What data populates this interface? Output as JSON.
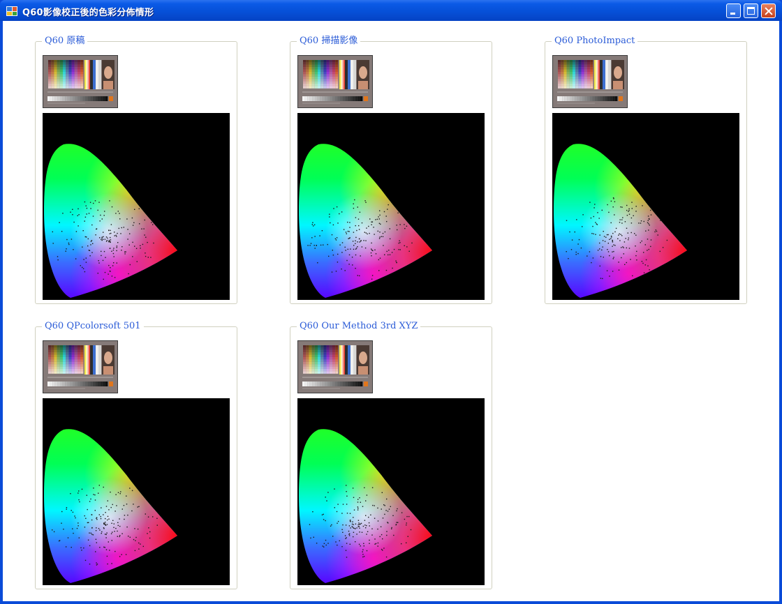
{
  "window": {
    "title": "Q60影像校正後的色彩分佈情形",
    "icon": "app-icon",
    "controls": {
      "minimize": "minimize-icon",
      "maximize": "maximize-icon",
      "close": "close-icon"
    }
  },
  "groups": [
    {
      "title": "Q60 原稿"
    },
    {
      "title": "Q60 掃描影像"
    },
    {
      "title": "Q60 PhotoImpact"
    },
    {
      "title": "Q60 QPcolorsoft 501"
    },
    {
      "title": "Q60 Our Method 3rd XYZ"
    }
  ],
  "colors": {
    "title_bar": "#0650d8",
    "group_title": "#2a5bd7",
    "plot_background": "#000000"
  }
}
